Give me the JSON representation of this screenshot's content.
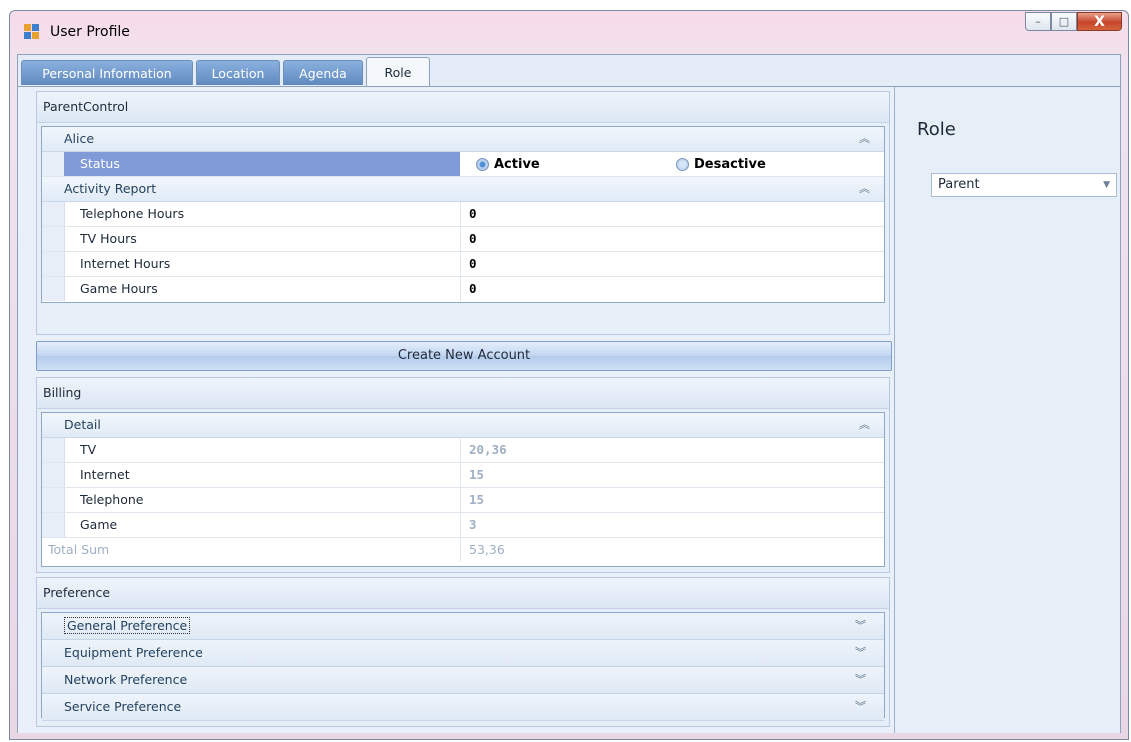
{
  "window": {
    "title": "User Profile",
    "buttons": {
      "minimize": "–",
      "maximize": "□",
      "close": "X"
    }
  },
  "tabs": [
    {
      "label": "Personal Information",
      "active": false
    },
    {
      "label": "Location",
      "active": false
    },
    {
      "label": "Agenda",
      "active": false
    },
    {
      "label": "Role",
      "active": true
    }
  ],
  "parent_control": {
    "header": "ParentControl",
    "alice": {
      "category": "Alice",
      "status_label": "Status",
      "options": [
        {
          "label": "Active",
          "selected": true
        },
        {
          "label": "Desactive",
          "selected": false
        }
      ]
    },
    "activity": {
      "category": "Activity Report",
      "rows": [
        {
          "name": "Telephone Hours",
          "value": "0"
        },
        {
          "name": "TV Hours",
          "value": "0"
        },
        {
          "name": "Internet Hours",
          "value": "0"
        },
        {
          "name": "Game Hours",
          "value": "0"
        }
      ]
    }
  },
  "create_button": "Create New Account",
  "billing": {
    "header": "Billing",
    "category": "Detail",
    "rows": [
      {
        "name": "TV",
        "value": "20,36"
      },
      {
        "name": "Internet",
        "value": "15"
      },
      {
        "name": "Telephone",
        "value": "15"
      },
      {
        "name": "Game",
        "value": "3"
      }
    ],
    "total_label": "Total Sum",
    "total_value": "53,36"
  },
  "preference": {
    "header": "Preference",
    "items": [
      "General Preference",
      "Equipment Preference",
      "Network Preference",
      "Service Preference"
    ]
  },
  "role_panel": {
    "title": "Role",
    "selected": "Parent"
  },
  "icons": {
    "collapse": "chevrons-up-icon",
    "expand": "chevrons-down-icon",
    "dropdown": "dropdown-arrow-icon"
  },
  "colors": {
    "selected_row": "#7f9ad6",
    "tab_inactive": "#5f89bf",
    "close_button": "#c6452a"
  }
}
